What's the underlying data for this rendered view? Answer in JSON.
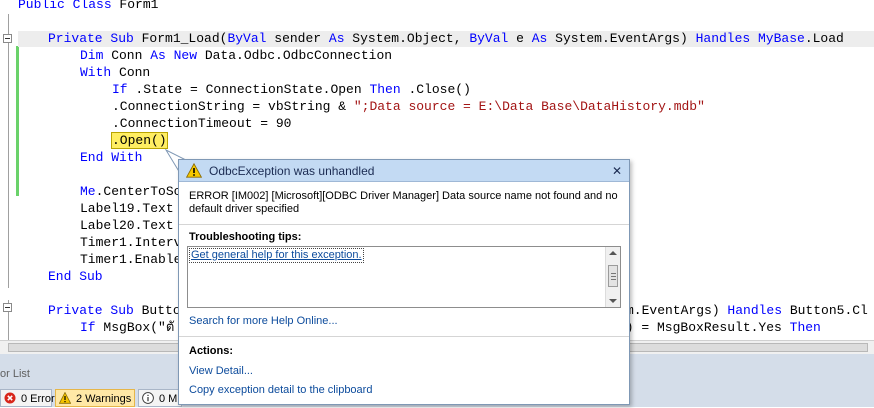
{
  "editor": {
    "line0": {
      "kw": "Public Class",
      "rest": " Form1"
    },
    "line1": {
      "kw1": "Private Sub",
      "a": " Form1_Load(",
      "kw2": "ByVal",
      "b": " sender ",
      "kw3": "As",
      "c": " System.Object, ",
      "kw4": "ByVal",
      "d": " e ",
      "kw5": "As",
      "e": " System.EventArgs) ",
      "kw6": "Handles MyBase",
      "f": ".Load"
    },
    "line2": {
      "kw1": "Dim",
      "a": " Conn ",
      "kw2": "As New",
      "b": " Data.Odbc.OdbcConnection"
    },
    "line3": {
      "kw1": "With",
      "a": " Conn"
    },
    "line4": {
      "kw1": "If",
      "a": " .State = ConnectionState.Open ",
      "kw2": "Then",
      "b": " .Close()"
    },
    "line5": {
      "a": ".ConnectionString = vbString & ",
      "str": "\";Data source = E:\\Data Base\\DataHistory.mdb\""
    },
    "line6": {
      "a": ".ConnectionTimeout = 90"
    },
    "line7": {
      "a": ".Open()"
    },
    "line8": {
      "kw1": "End With"
    },
    "line9": {
      "kw1": "Me",
      "a": ".CenterToSc"
    },
    "line10": {
      "a": "Label19.Text"
    },
    "line11": {
      "a": "Label20.Text"
    },
    "line12": {
      "a": "Timer1.Interv"
    },
    "line13": {
      "a": "Timer1.Enable"
    },
    "line14": {
      "kw1": "End Sub"
    },
    "line15": {
      "kw1": "Private Sub",
      "a": " Butto",
      "b": "m.EventArgs) ",
      "kw2": "Handles",
      "c": " Button5.Cl"
    },
    "line16": {
      "kw1": "If",
      "a": " MsgBox(\"ตั",
      "b": "\") = MsgBoxResult.Yes ",
      "kw2": "Then"
    }
  },
  "popup": {
    "title": "OdbcException was unhandled",
    "message": "ERROR [IM002] [Microsoft][ODBC Driver Manager] Data source name not found and no default driver specified",
    "tips_heading": "Troubleshooting tips:",
    "tips_link": "Get general help for this exception.",
    "search_link": "Search for more Help Online...",
    "actions_heading": "Actions:",
    "action_view": "View Detail...",
    "action_copy": "Copy exception detail to the clipboard",
    "close_glyph": "✕"
  },
  "errorlist": {
    "title": "or List",
    "errors": "0 Errors",
    "warnings": "2 Warnings",
    "messages": "0 M"
  },
  "colors": {
    "keyword": "#0000ff",
    "string": "#a31515",
    "link": "#0c4b9c",
    "popup_header": "#c3daf3",
    "highlight": "#ffee62"
  }
}
